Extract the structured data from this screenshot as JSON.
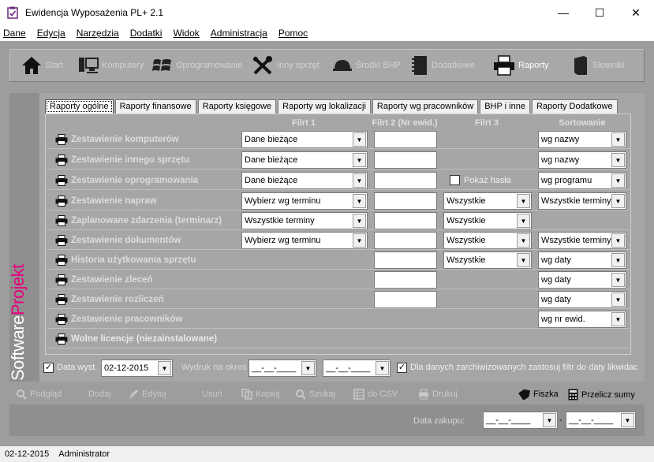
{
  "window": {
    "title": "Ewidencja Wyposażenia PL+ 2.1",
    "minimize": "—",
    "maximize": "☐",
    "close": "✕"
  },
  "menu": [
    "Dane",
    "Edycja",
    "Narzędzia",
    "Dodatki",
    "Widok",
    "Administracja",
    "Pomoc"
  ],
  "toolbar": [
    {
      "label": "Start",
      "icon": "home-icon"
    },
    {
      "label": "Komputery",
      "icon": "computer-icon"
    },
    {
      "label": "Oprogramowanie",
      "icon": "windows-icon"
    },
    {
      "label": "Inny sprzęt",
      "icon": "tools-icon"
    },
    {
      "label": "Środki BHP",
      "icon": "helmet-icon"
    },
    {
      "label": "Dodatkowe",
      "icon": "notebook-icon"
    },
    {
      "label": "Raporty",
      "icon": "printer-icon",
      "active": true
    },
    {
      "label": "Słowniki",
      "icon": "book-icon"
    }
  ],
  "brand": {
    "part1": "Software",
    "part2": "Projekt"
  },
  "tabs": [
    "Raporty ogólne",
    "Raporty finansowe",
    "Raporty księgowe",
    "Raporty wg lokalizacji",
    "Raporty wg pracowników",
    "BHP i inne",
    "Raporty Dodatkowe"
  ],
  "columns": {
    "filtr1": "Filrt 1",
    "filtr2": "Filrt 2 (Nr ewid.)",
    "filtr3": "Filrt 3",
    "sort": "Sortowanie"
  },
  "reports": [
    {
      "label": "Zestawienie komputerów",
      "filtr1": "Dane bieżące",
      "filtr2": true,
      "filtr3": null,
      "sort": "wg nazwy"
    },
    {
      "label": "Zestawienie innego sprzętu",
      "filtr1": "Dane bieżące",
      "filtr2": true,
      "filtr3": null,
      "sort": "wg nazwy"
    },
    {
      "label": "Zestawienie oprogramowania",
      "filtr1": "Dane bieżące",
      "filtr2": true,
      "filtr3_checkbox": "Pokaż hasła",
      "sort": "wg programu"
    },
    {
      "label": "Zestawienie napraw",
      "filtr1": "Wybierz wg terminu",
      "filtr2": true,
      "filtr3": "Wszystkie",
      "sort": "Wszystkie terminy"
    },
    {
      "label": "Zaplanowane zdarzenia (terminarz)",
      "filtr1": "Wszystkie terminy",
      "filtr2": true,
      "filtr3": "Wszystkie",
      "sort": null
    },
    {
      "label": "Zestawienie dokumentów",
      "filtr1": "Wybierz wg terminu",
      "filtr2": true,
      "filtr3": "Wszystkie",
      "sort": "Wszystkie terminy"
    },
    {
      "label": "Historia użytkowania sprzętu",
      "filtr1": null,
      "filtr2": true,
      "filtr3": "Wszystkie",
      "sort": "wg daty"
    },
    {
      "label": "Zestawienie zleceń",
      "filtr1": null,
      "filtr2": true,
      "filtr3": null,
      "sort": "wg daty"
    },
    {
      "label": "Zestawienie rozliczeń",
      "filtr1": null,
      "filtr2": true,
      "filtr3": null,
      "sort": "wg daty"
    },
    {
      "label": "Zestawienie pracowników",
      "filtr1": null,
      "filtr2": false,
      "filtr3": null,
      "sort": "wg nr ewid."
    },
    {
      "label": "Wolne licencje (niezainstalowane)",
      "filtr1": null,
      "filtr2": false,
      "filtr3": null,
      "sort": null
    }
  ],
  "footer_filters": {
    "date_label": "Data wyst.",
    "date_value": "02-12-2015",
    "printout_label": "Wydruk na okres",
    "date_from": "__-__-____",
    "date_to": "__-__-____",
    "archive_label": "Dla danych zarchiwizowanych zastosuj filtr do daty likwidac"
  },
  "actions": [
    {
      "label": "Podgląd",
      "icon": "preview-icon"
    },
    {
      "label": "Dodaj",
      "icon": "add-icon"
    },
    {
      "label": "Edytuj",
      "icon": "edit-icon"
    },
    {
      "label": "Usuń",
      "icon": "delete-icon"
    },
    {
      "label": "Kopiuj",
      "icon": "copy-icon"
    },
    {
      "label": "Szukaj",
      "icon": "search-icon"
    },
    {
      "label": "do CSV",
      "icon": "csv-icon"
    },
    {
      "label": "Drukuj",
      "icon": "print-icon"
    },
    {
      "label": "Fiszka",
      "icon": "tag-icon"
    },
    {
      "label": "Przelicz sumy",
      "icon": "calculator-icon"
    }
  ],
  "purchase": {
    "label": "Data zakupu:",
    "from": "__-__-____",
    "sep": "-",
    "to": "__-__-____"
  },
  "status": {
    "date": "02-12-2015",
    "user": "Administrator"
  }
}
